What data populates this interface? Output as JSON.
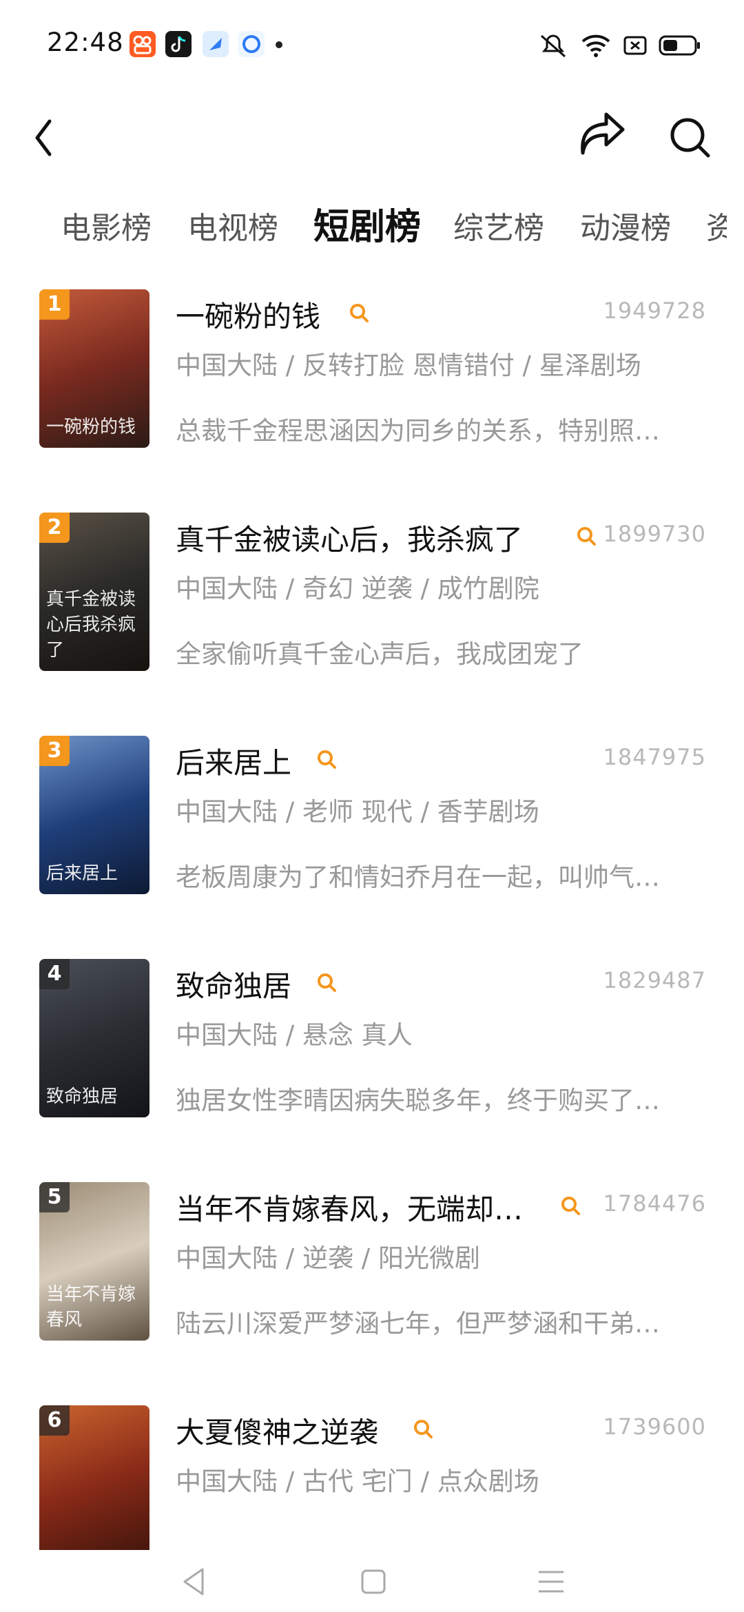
{
  "status_bar": {
    "time": "22:48",
    "app_icons": [
      "kuaishou-icon",
      "tiktok-icon",
      "blue-app-icon",
      "qq-icon"
    ],
    "system_icons": [
      "mute-icon",
      "wifi-icon",
      "sim-icon",
      "battery-icon"
    ]
  },
  "header": {
    "icons": [
      "back-icon",
      "share-icon",
      "search-icon"
    ]
  },
  "tabs": [
    {
      "label": "电影榜",
      "active": false
    },
    {
      "label": "电视榜",
      "active": false
    },
    {
      "label": "短剧榜",
      "active": true
    },
    {
      "label": "综艺榜",
      "active": false
    },
    {
      "label": "动漫榜",
      "active": false
    }
  ],
  "colors": {
    "accent": "#f5961d",
    "rank_dark": "#282828",
    "text_primary": "#111111",
    "text_secondary": "#999999",
    "score": "#b8b8b8"
  },
  "items": [
    {
      "rank": "1",
      "title": "一碗粉的钱",
      "score": "1949728",
      "meta": "中国大陆 / 反转打脸 恩情错付 / 星泽剧场",
      "desc": "总裁千金程思涵因为同乡的关系，特别照…",
      "poster_caption": "一碗粉的钱",
      "poster_colors": [
        "#7a2a1f",
        "#c45b3b",
        "#2b1b16"
      ]
    },
    {
      "rank": "2",
      "title": "真千金被读心后，我杀疯了",
      "score": "1899730",
      "meta": "中国大陆 / 奇幻 逆袭 / 成竹剧院",
      "desc": "全家偷听真千金心声后，我成团宠了",
      "poster_caption": "真千金被读心后我杀疯了",
      "poster_colors": [
        "#2a2a28",
        "#5b5246",
        "#16130f"
      ]
    },
    {
      "rank": "3",
      "title": "后来居上",
      "score": "1847975",
      "meta": "中国大陆 / 老师 现代 / 香芋剧场",
      "desc": "老板周康为了和情妇乔月在一起，叫帅气…",
      "poster_caption": "后来居上",
      "poster_colors": [
        "#1f3f7a",
        "#6f93c9",
        "#0d1a33"
      ]
    },
    {
      "rank": "4",
      "title": "致命独居",
      "score": "1829487",
      "meta": "中国大陆 / 悬念 真人",
      "desc": "独居女性李晴因病失聪多年，终于购买了…",
      "poster_caption": "致命独居",
      "poster_colors": [
        "#2b2d33",
        "#4a4f58",
        "#121418"
      ]
    },
    {
      "rank": "5",
      "title": "当年不肯嫁春风，无端却…",
      "score": "1784476",
      "meta": "中国大陆 / 逆袭 / 阳光微剧",
      "desc": "陆云川深爱严梦涵七年，但严梦涵和干弟…",
      "poster_caption": "当年不肯嫁春风",
      "poster_colors": [
        "#d8cdbd",
        "#9b8c75",
        "#5e5142"
      ]
    },
    {
      "rank": "6",
      "title": "大夏傻神之逆袭",
      "score": "1739600",
      "meta": "中国大陆 / 古代 宅门 / 点众剧场",
      "desc": "",
      "poster_caption": "",
      "poster_colors": [
        "#8a2a18",
        "#c9642e",
        "#3b140b"
      ]
    }
  ],
  "bottom_nav": [
    "nav-back-icon",
    "nav-home-icon",
    "nav-menu-icon"
  ]
}
